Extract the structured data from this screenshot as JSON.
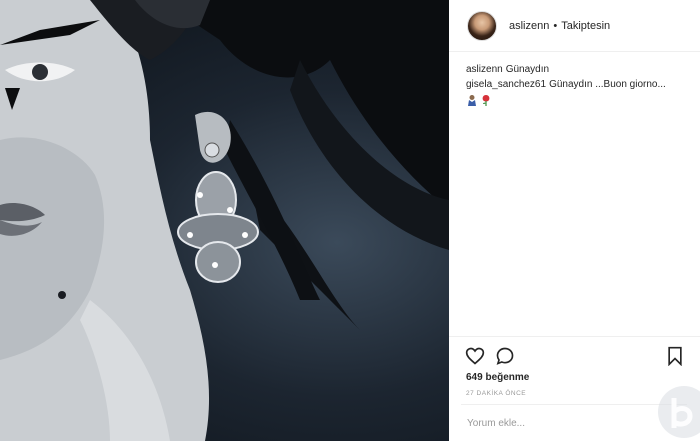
{
  "post": {
    "author": "aslizenn",
    "separator": "•",
    "follow_status": "Takiptesin"
  },
  "comments": [
    {
      "user": "aslizenn",
      "text": "Günaydın"
    },
    {
      "user": "gisela_sanchez61",
      "text": "Günaydın ...Buon giorno..."
    }
  ],
  "comment_emojis": [
    "praying-hands-emoji",
    "rose-emoji"
  ],
  "actions": {
    "like_icon": "heart-icon",
    "comment_icon": "speech-bubble-icon",
    "save_icon": "bookmark-icon"
  },
  "likes_text": "649 beğenme",
  "timestamp": "27 DAKİKA ÖNCE",
  "comment_placeholder": "Yorum ekle...",
  "colors": {
    "text": "#262626",
    "muted": "#999999",
    "border": "#efefef"
  }
}
